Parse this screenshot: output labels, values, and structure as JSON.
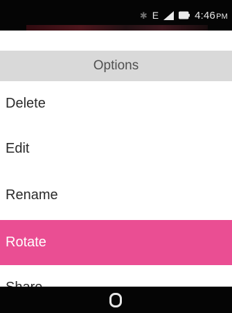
{
  "status_bar": {
    "bluetooth_icon": "bluetooth-icon",
    "network_type": "E",
    "signal_icon": "signal-icon",
    "battery_icon": "battery-icon",
    "time": "4:46",
    "ampm": "PM"
  },
  "header": {
    "title": "Options"
  },
  "menu": {
    "items": [
      {
        "label": "Delete"
      },
      {
        "label": "Edit"
      },
      {
        "label": "Rename"
      },
      {
        "label": "Rotate"
      },
      {
        "label": "Share"
      }
    ],
    "selected_label": "Rotate"
  },
  "softkeys": {
    "home_icon": "home-key-icon"
  },
  "colors": {
    "highlight": "#ea4e93",
    "status_bar_bg": "#050505",
    "header_bg": "#d9d9d9",
    "softkey_bg": "#050505"
  }
}
